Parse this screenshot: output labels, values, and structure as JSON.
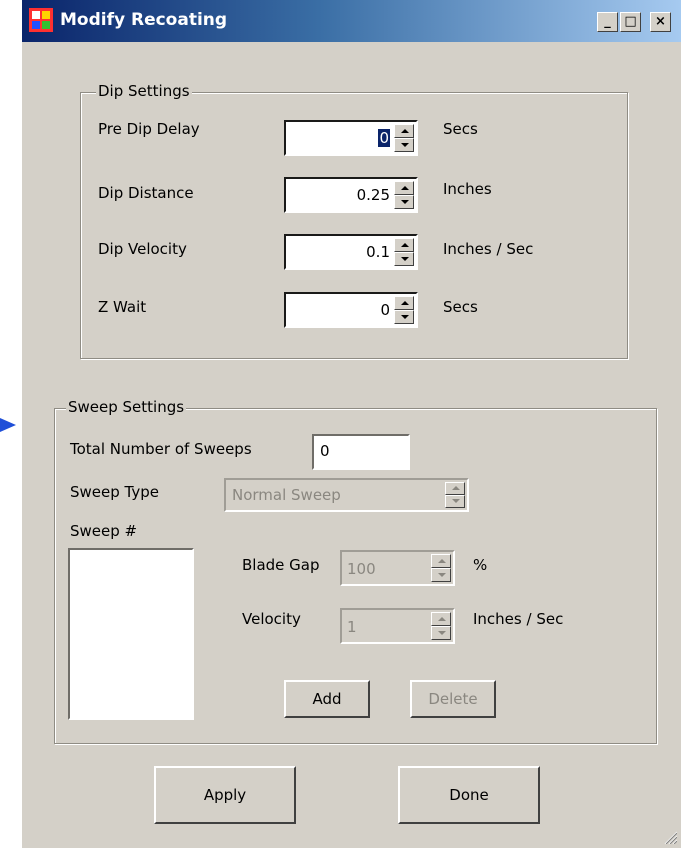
{
  "window": {
    "title": "Modify Recoating",
    "controls": {
      "minimize": "_",
      "maximize": "□",
      "close": "×"
    }
  },
  "dip_settings": {
    "legend": "Dip Settings",
    "rows": [
      {
        "label": "Pre Dip Delay",
        "value": "0",
        "unit": "Secs"
      },
      {
        "label": "Dip Distance",
        "value": "0.25",
        "unit": "Inches"
      },
      {
        "label": "Dip Velocity",
        "value": "0.1",
        "unit": "Inches / Sec"
      },
      {
        "label": "Z Wait",
        "value": "0",
        "unit": "Secs"
      }
    ]
  },
  "sweep_settings": {
    "legend": "Sweep Settings",
    "total_label": "Total Number of Sweeps",
    "total_value": "0",
    "type_label": "Sweep Type",
    "type_value": "Normal Sweep",
    "sweep_list_label": "Sweep #",
    "blade_gap_label": "Blade Gap",
    "blade_gap_value": "100",
    "blade_gap_unit": "%",
    "velocity_label": "Velocity",
    "velocity_value": "1",
    "velocity_unit": "Inches / Sec",
    "add_label": "Add",
    "delete_label": "Delete"
  },
  "footer": {
    "apply_label": "Apply",
    "done_label": "Done"
  },
  "colors": {
    "dialog_bg": "#d4d0c8",
    "title_start": "#0a246a",
    "title_end": "#a6caf0",
    "pointer_arrow": "#1f4fd8"
  }
}
